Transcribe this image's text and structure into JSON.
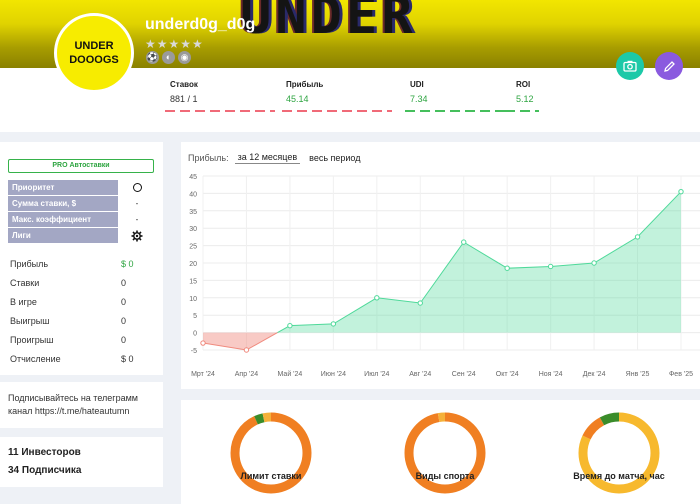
{
  "banner": {
    "art_text": "UNDER"
  },
  "profile": {
    "avatar_line1": "UNDER",
    "avatar_line2": "DOOOGS",
    "username": "underd0g_d0g",
    "stars": "★★★★★"
  },
  "stats": [
    {
      "label": "Ставок",
      "value": "881 / 1",
      "value_color": "#333333"
    },
    {
      "label": "Прибыль",
      "value": "45.14",
      "value_color": "#2fa542"
    },
    {
      "label": "UDI",
      "value": "7.34",
      "value_color": "#2fa542"
    },
    {
      "label": "ROI",
      "value": "5.12",
      "value_color": "#2fa542"
    }
  ],
  "pro": {
    "label": "PRO Автоставки"
  },
  "settings": [
    {
      "label": "Приоритет",
      "value": ""
    },
    {
      "label": "Сумма ставки, $",
      "value": "-"
    },
    {
      "label": "Макс. коэффициент",
      "value": "-"
    },
    {
      "label": "Лиги",
      "value": ""
    }
  ],
  "metrics": [
    {
      "label": "Прибыль",
      "value": "$ 0",
      "color": "#2fa542"
    },
    {
      "label": "Ставки",
      "value": "0",
      "color": "#333333"
    },
    {
      "label": "В игре",
      "value": "0",
      "color": "#333333"
    },
    {
      "label": "Выигрыш",
      "value": "0",
      "color": "#333333"
    },
    {
      "label": "Проигрыш",
      "value": "0",
      "color": "#333333"
    },
    {
      "label": "Отчисление",
      "value": "$ 0",
      "color": "#333333"
    }
  ],
  "telegram": {
    "text": "Подписывайтесь на телеграмм канал https://t.me/hateautumn"
  },
  "community": {
    "investors": "11 Инвесторов",
    "subscribers": "34 Подписчика"
  },
  "chart_filters": {
    "label": "Прибыль:",
    "option_12m": "за 12 месяцев",
    "option_all": "весь период"
  },
  "chart_data": {
    "type": "area",
    "categories": [
      "Мрт '24",
      "Апр '24",
      "Май '24",
      "Июн '24",
      "Июл '24",
      "Авг '24",
      "Сен '24",
      "Окт '24",
      "Ноя '24",
      "Дек '24",
      "Янв '25",
      "Фев '25"
    ],
    "values": [
      -3,
      -5,
      2,
      2.5,
      10,
      8.5,
      26,
      18.5,
      19,
      20,
      27.5,
      40.5
    ],
    "ylim": [
      -5,
      45
    ],
    "yticks": [
      -5,
      0,
      5,
      10,
      15,
      20,
      25,
      30,
      35,
      40,
      45
    ],
    "grid": true,
    "positive_color": "#4fd99a",
    "negative_color": "#f08a7e"
  },
  "donuts": [
    {
      "title": "Лимит ставки",
      "segments": [
        {
          "value": 0.93,
          "color": "#f07f22"
        },
        {
          "value": 0.035,
          "color": "#3a8c2a"
        },
        {
          "value": 0.035,
          "color": "#f5b13a"
        }
      ]
    },
    {
      "title": "Виды спорта",
      "segments": [
        {
          "value": 0.97,
          "color": "#f07f22"
        },
        {
          "value": 0.03,
          "color": "#f5b13a"
        }
      ]
    },
    {
      "title": "Время до матча, час",
      "segments": [
        {
          "value": 0.82,
          "color": "#f7b92e"
        },
        {
          "value": 0.1,
          "color": "#f07f22"
        },
        {
          "value": 0.08,
          "color": "#3a8c2a"
        }
      ]
    }
  ]
}
